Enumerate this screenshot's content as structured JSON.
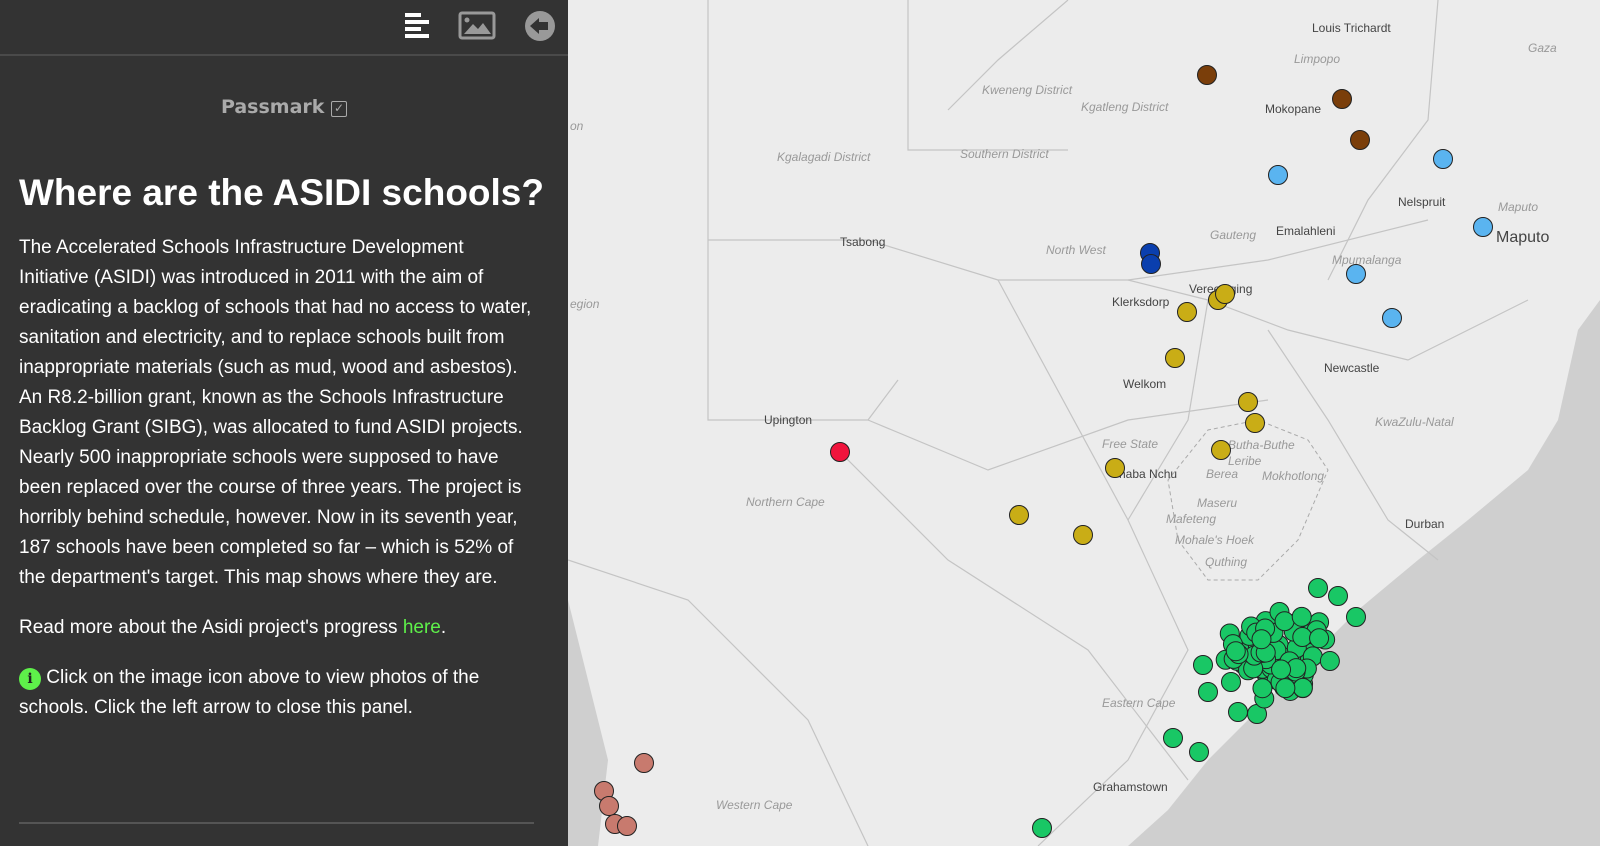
{
  "panel": {
    "toolbar": {
      "icons": [
        "list-icon",
        "image-icon",
        "arrow-left-circle-icon"
      ]
    },
    "brand": "Passmark",
    "title": "Where are the ASIDI schools?",
    "body": "The Accelerated Schools Infrastructure Development Initiative (ASIDI) was introduced in 2011 with the aim of eradicating a backlog of schools that had no access to water, sanitation and electricity, and to replace schools built from inappropriate materials (such as mud, wood and asbestos). An R8.2-billion grant, known as the Schools Infrastructure Backlog Grant (SIBG), was allocated to fund ASIDI projects. Nearly 500 inappropriate schools were supposed to have been replaced over the course of three years. The project is horribly behind schedule, however. Now in its seventh year, 187 schools have been completed so far – which is 52% of the department's target. This map shows where they are.",
    "read_more": "Read more about the Asidi project's progress ",
    "link": "here",
    "link_suffix": ".",
    "info": "Click on the image icon above to view photos of the schools. Click the left arrow to close this panel."
  },
  "map": {
    "labels": [
      "Louis Trichardt",
      "Limpopo",
      "Gaza",
      "Kweneng District",
      "Kgatleng District",
      "Mokopane",
      "Kgalagadi District",
      "Southern District",
      "Nelspruit",
      "Maputo",
      "Maputo",
      "Tsabong",
      "North West",
      "Gauteng",
      "Emalahleni",
      "Mpumalanga",
      "Klerksdorp",
      "Vereeniging",
      "Newcastle",
      "Welkom",
      "Upington",
      "KwaZulu-Natal",
      "Free State",
      "Butha-Buthe",
      "Leribe",
      "haba Nchu",
      "Berea",
      "Mokhotlong",
      "Northern Cape",
      "Maseru",
      "Mafeteng",
      "Durban",
      "Mohale's Hoek",
      "Quthing",
      "Eastern Cape",
      "Grahamstown",
      "Western Cape",
      "egion",
      "on"
    ],
    "marker_colors": {
      "brown": "#7a3e0a",
      "light_blue": "#5ab4f0",
      "dark_blue": "#0a3fae",
      "red": "#f0143c",
      "yellow": "#c9ad16",
      "salmon": "#c87a6e",
      "green": "#19c765"
    },
    "land": "#ececec",
    "sea": "#cfcfcf"
  }
}
